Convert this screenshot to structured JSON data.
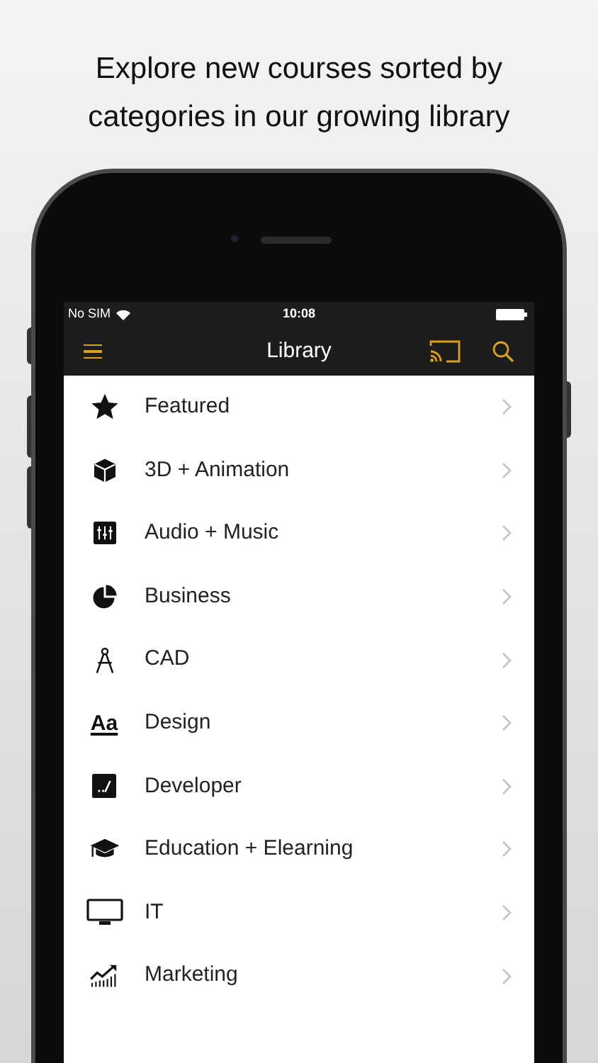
{
  "headline": "Explore new courses sorted by categories in our growing library",
  "status_bar": {
    "carrier": "No SIM",
    "time": "10:08"
  },
  "nav_bar": {
    "title": "Library"
  },
  "categories": [
    {
      "label": "Featured"
    },
    {
      "label": "3D + Animation"
    },
    {
      "label": "Audio + Music"
    },
    {
      "label": "Business"
    },
    {
      "label": "CAD"
    },
    {
      "label": "Design",
      "icon_text": "Aa"
    },
    {
      "label": "Developer"
    },
    {
      "label": "Education + Elearning"
    },
    {
      "label": "IT"
    },
    {
      "label": "Marketing"
    }
  ]
}
